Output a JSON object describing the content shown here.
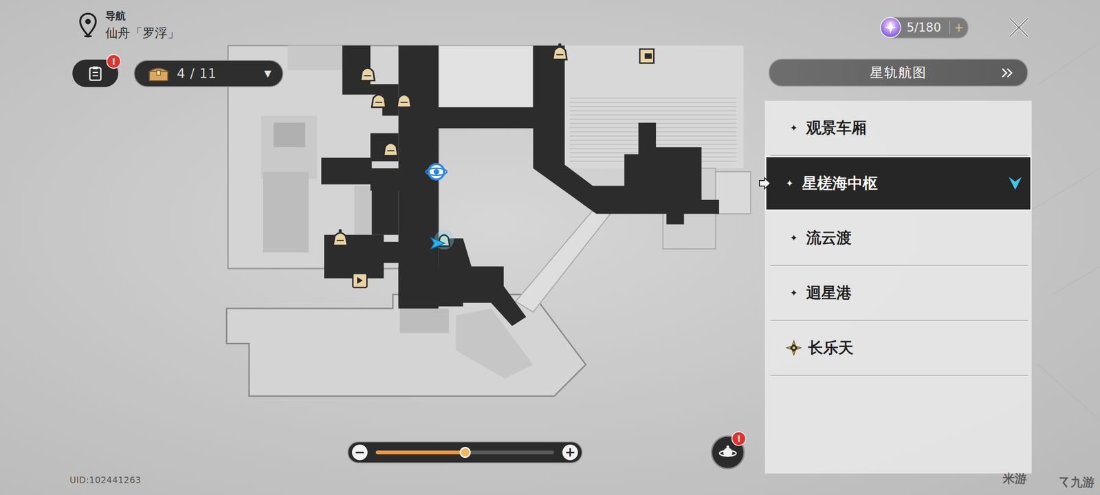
{
  "header": {
    "title": "导航",
    "location": "仙舟「罗浮」"
  },
  "quest": {
    "badge": "!"
  },
  "chest": {
    "count": "4 / 11",
    "dropdown": "▼"
  },
  "currency": {
    "amount": "5/180",
    "add": "+"
  },
  "star_rail_map": {
    "label": "星轨航图"
  },
  "area_list": {
    "bullet": "✦",
    "items": [
      {
        "label": "观景车厢",
        "selected": false,
        "current": false
      },
      {
        "label": "星槎海中枢",
        "selected": true,
        "current": false
      },
      {
        "label": "流云渡",
        "selected": false,
        "current": false
      },
      {
        "label": "迴星港",
        "selected": false,
        "current": false
      },
      {
        "label": "长乐天",
        "selected": false,
        "current": true
      }
    ]
  },
  "zoom": {
    "minus": "−",
    "plus": "+",
    "level": 0.5
  },
  "events": {
    "badge": "!"
  },
  "uid": "UID:102441263",
  "watermarks": [
    "米游",
    "九游"
  ]
}
